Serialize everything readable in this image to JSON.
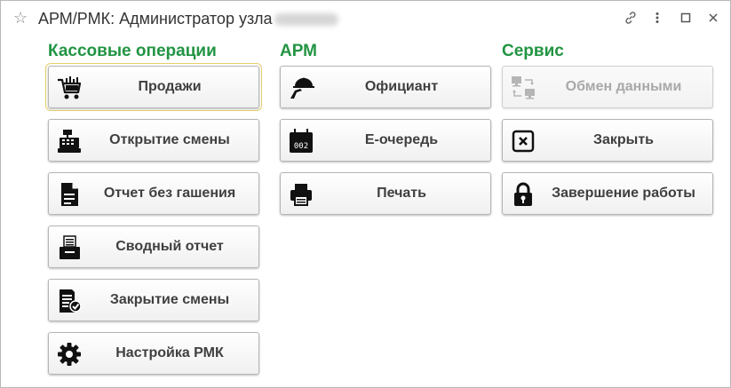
{
  "window": {
    "title": "АРМ/РМК: Администратор узла",
    "star_icon": "star-icon",
    "link_icon": "link-icon",
    "menu_icon": "more-vertical-icon",
    "maximize_icon": "maximize-icon",
    "close_icon": "close-icon"
  },
  "sections": {
    "cash": {
      "title": "Кассовые операции",
      "buttons": [
        {
          "label": "Продажи",
          "icon": "shopping-cart-icon"
        },
        {
          "label": "Открытие смены",
          "icon": "cash-register-icon"
        },
        {
          "label": "Отчет без гашения",
          "icon": "document-icon"
        },
        {
          "label": "Сводный отчет",
          "icon": "report-printer-icon"
        },
        {
          "label": "Закрытие смены",
          "icon": "document-check-icon"
        },
        {
          "label": "Настройка РМК",
          "icon": "gear-icon"
        }
      ]
    },
    "arm": {
      "title": "АРМ",
      "buttons": [
        {
          "label": "Официант",
          "icon": "waiter-tray-icon"
        },
        {
          "label": "E-очередь",
          "icon": "queue-display-icon",
          "display": "002"
        },
        {
          "label": "Печать",
          "icon": "printer-icon"
        }
      ]
    },
    "service": {
      "title": "Сервис",
      "buttons": [
        {
          "label": "Обмен данными",
          "icon": "data-exchange-icon",
          "disabled": true
        },
        {
          "label": "Закрыть",
          "icon": "close-box-icon"
        },
        {
          "label": "Завершение работы",
          "icon": "padlock-icon"
        }
      ]
    }
  },
  "colors": {
    "section_title": "#229443",
    "focus_outline": "#e6cf6a",
    "button_text": "#3f3f3f",
    "disabled_text": "#a8a8a8"
  }
}
